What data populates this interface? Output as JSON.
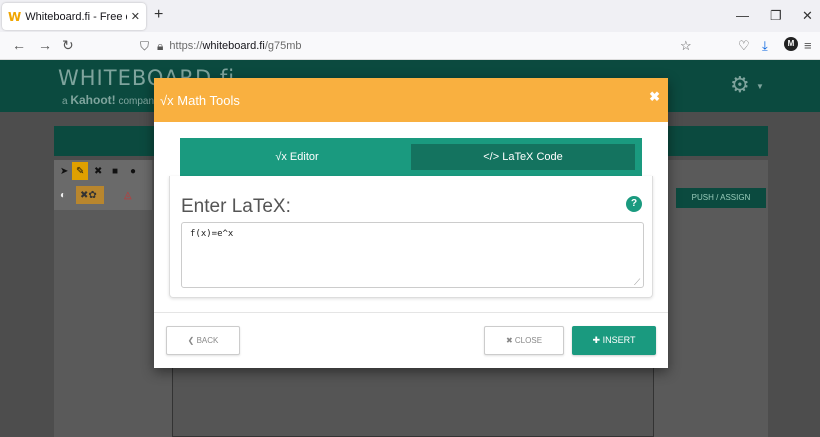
{
  "browser": {
    "tab_title": "Whiteboard.fi - Free online whi",
    "tab_favicon": "W",
    "url_prefix": "https://",
    "url_domain": "whiteboard.fi",
    "url_path": "/g75mb",
    "avatar_letter": "M"
  },
  "app": {
    "logo_text": "WHITEBOARD.fi",
    "logo_sub_prefix": "a",
    "logo_sub_brand": "Kahoot!",
    "logo_sub_suffix": "compan",
    "push_assign_label": "PUSH / ASSIGN",
    "accent_color": "#1a9a7f",
    "header_color": "#f9b040"
  },
  "modal": {
    "title": "Math Tools",
    "title_icon": "√x",
    "close_glyph": "✖",
    "tabs": [
      {
        "icon": "√x",
        "label": "Editor"
      },
      {
        "icon": "</>",
        "label": "LaTeX Code"
      }
    ],
    "enter_label": "Enter LaTeX:",
    "help_glyph": "?",
    "latex_value": "f(x)=e^x",
    "back_label": "BACK",
    "close_label": "CLOSE",
    "insert_label": "INSERT"
  }
}
